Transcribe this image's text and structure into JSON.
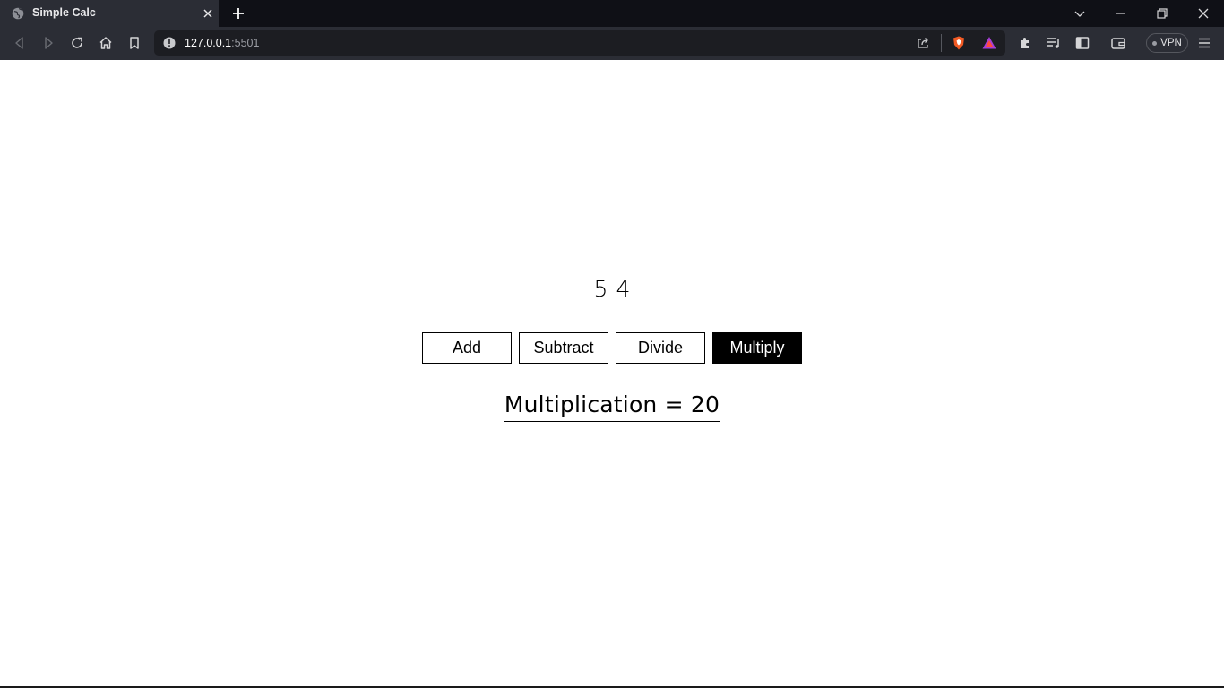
{
  "browser": {
    "tab": {
      "title": "Simple Calc",
      "favicon": "globe-icon"
    },
    "url": {
      "host": "127.0.0.1",
      "port": ":5501"
    },
    "vpn_label": "VPN"
  },
  "calculator": {
    "input_a": "5",
    "input_b": "4",
    "buttons": {
      "add": "Add",
      "subtract": "Subtract",
      "divide": "Divide",
      "multiply": "Multiply"
    },
    "active_operation": "multiply",
    "result_text": "Multiplication = 20"
  },
  "colors": {
    "chrome_dark": "#0f1016",
    "chrome_toolbar": "#2b2d35",
    "page_bg": "#ffffff",
    "active_button_bg": "#000000"
  }
}
